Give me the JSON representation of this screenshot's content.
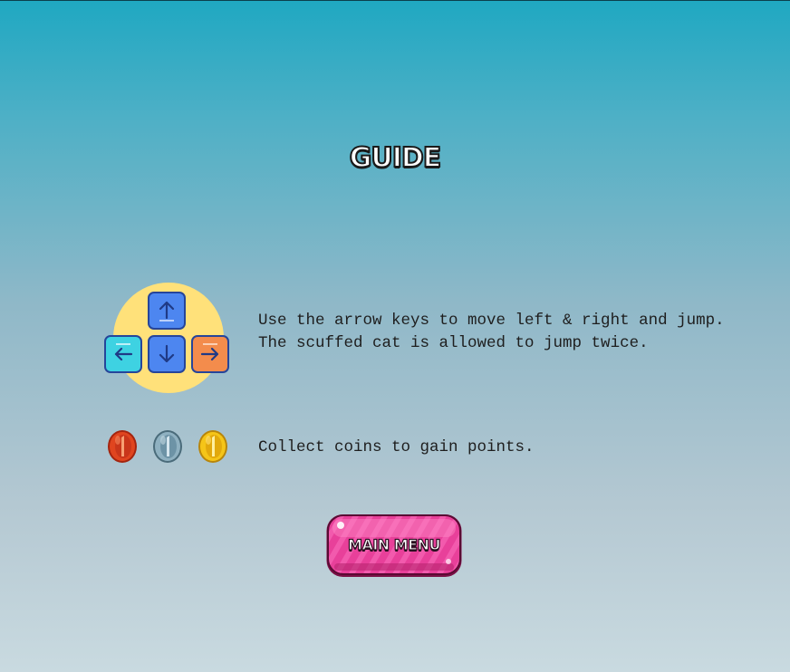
{
  "screen": {
    "title": "GUIDE"
  },
  "controls_section": {
    "icon": "arrow-keys-icon",
    "keys": [
      "up-arrow-key",
      "left-arrow-key",
      "down-arrow-key",
      "right-arrow-key"
    ],
    "line1": "Use the arrow keys to move left & right and jump.",
    "line2": "The scuffed cat is allowed to jump twice."
  },
  "coins_section": {
    "icons": [
      "red-coin-icon",
      "silver-coin-icon",
      "gold-coin-icon"
    ],
    "text": "Collect coins to gain points."
  },
  "main_menu_button": {
    "label": "MAIN MENU",
    "color": "#e8409a"
  },
  "colors": {
    "background_top": "#1fa8c2",
    "background_bottom": "#c9dae0",
    "key_blue": "#4d86f0",
    "key_cyan": "#3ed2e2",
    "key_orange": "#f38c4c",
    "circle_yellow": "#ffe17a"
  }
}
